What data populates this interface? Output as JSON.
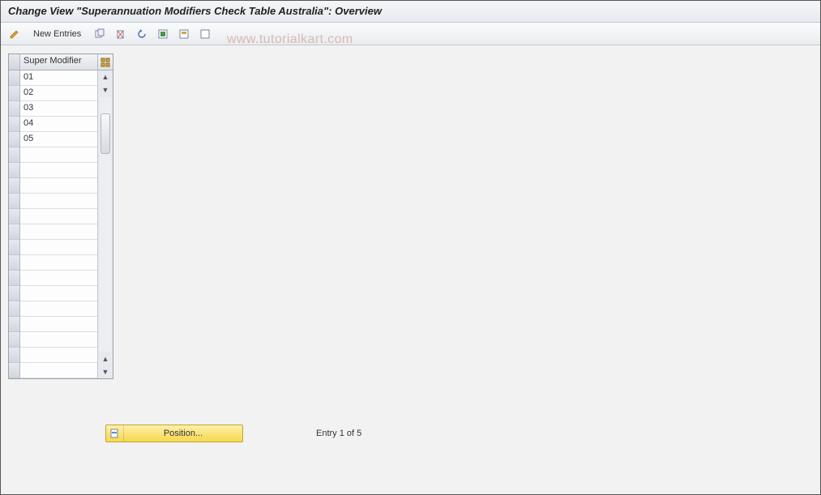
{
  "title": "Change View \"Superannuation Modifiers Check Table Australia\": Overview",
  "toolbar": {
    "new_entries_label": "New Entries"
  },
  "table": {
    "column_header": "Super Modifier",
    "rows": [
      "01",
      "02",
      "03",
      "04",
      "05"
    ],
    "total_visible_rows": 20
  },
  "footer": {
    "position_label": "Position...",
    "entry_text": "Entry 1 of 5"
  },
  "watermark": "www.tutorialkart.com"
}
